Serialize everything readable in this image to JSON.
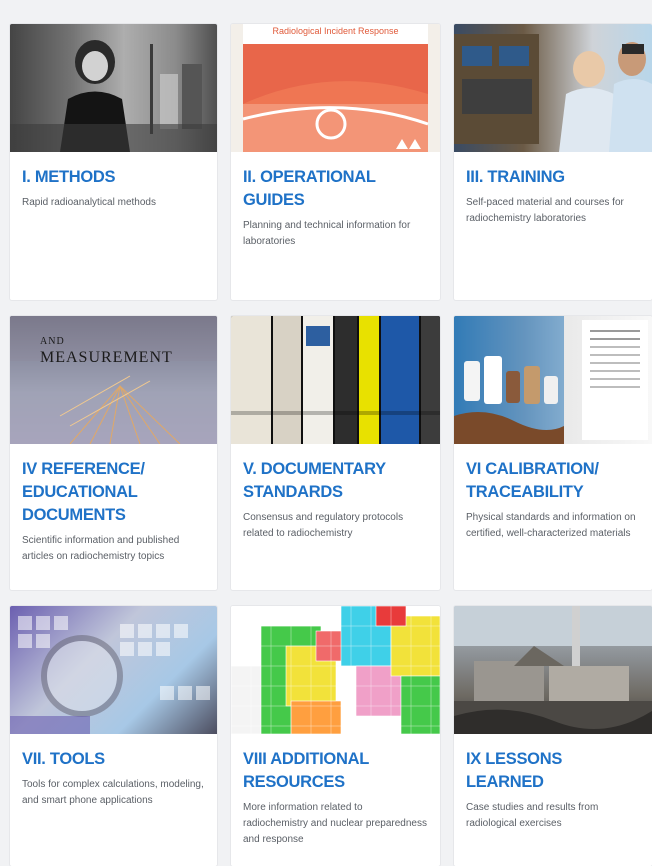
{
  "cards": [
    {
      "title": "I. METHODS",
      "description": "Rapid radioanalytical methods",
      "image": "photo-scientist-lab"
    },
    {
      "title": "II. OPERATIONAL GUIDES",
      "description": "Planning and technical information for laboratories",
      "image": "cover-radiological-incident-response",
      "image_caption": "Radiological Incident Response"
    },
    {
      "title": "III. TRAINING",
      "description": "Self-paced  material and courses for radiochemistry laboratories",
      "image": "photo-lab-training"
    },
    {
      "title": "IV REFERENCE/ EDUCATIONAL DOCUMENTS",
      "description": "Scientific information and published articles on radiochemistry topics",
      "image": "book-cover-detection-measurement",
      "image_text_and": "AND",
      "image_text_measurement": "MEASUREMENT"
    },
    {
      "title": "V. DOCUMENTARY STANDARDS",
      "description": "Consensus and regulatory protocols related to radiochemistry",
      "image": "photo-standards-books"
    },
    {
      "title": "VI CALIBRATION/ TRACEABILITY",
      "description": "Physical standards and information on certified, well-characterized materials",
      "image": "photo-reference-materials"
    },
    {
      "title": "VII. TOOLS",
      "description": "Tools for complex calculations, modeling, and smart phone applications",
      "image": "photo-periodic-table-magnifier"
    },
    {
      "title": "VIII ADDITIONAL RESOURCES",
      "description": "More information related to radiochemistry and nuclear preparedness and response",
      "image": "chart-of-nuclides"
    },
    {
      "title": "IX LESSONS LEARNED",
      "description": "Case studies and results from radiological exercises",
      "image": "photo-damaged-reactor"
    }
  ]
}
